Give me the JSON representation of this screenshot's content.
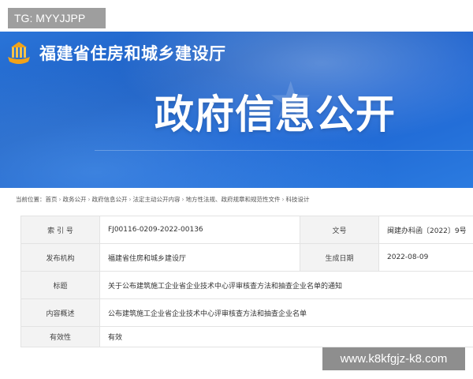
{
  "watermark_top": "TG: MYYJJPP",
  "watermark_bottom": "www.k8kfgjz-k8.com",
  "header": {
    "department": "福建省住房和城乡建设厅",
    "title": "政府信息公开"
  },
  "breadcrumb": {
    "prefix": "当前位置：",
    "items": [
      "首页",
      "政务公开",
      "政府信息公开",
      "法定主动公开内容",
      "地方性法规、政府规章和规范性文件",
      "科技设计"
    ],
    "separator": "›"
  },
  "info": {
    "index_label": "索 引 号",
    "index_value": "FJ00116-0209-2022-00136",
    "doc_no_label": "文号",
    "doc_no_value": "闽建办科函〔2022〕9号",
    "publisher_label": "发布机构",
    "publisher_value": "福建省住房和城乡建设厅",
    "date_label": "生成日期",
    "date_value": "2022-08-09",
    "title_label": "标题",
    "title_value": "关于公布建筑施工企业省企业技术中心评审核查方法和抽查企业名单的通知",
    "summary_label": "内容概述",
    "summary_value": "公布建筑施工企业省企业技术中心评审核查方法和抽查企业名单",
    "validity_label": "有效性",
    "validity_value": "有效"
  },
  "colors": {
    "header_blue": "#1d5fc4",
    "table_key_bg": "#f3f3f3",
    "table_border": "#e3e3e3"
  },
  "icons": {
    "logo": "emblem-logo-icon",
    "decor": "star-icon"
  }
}
